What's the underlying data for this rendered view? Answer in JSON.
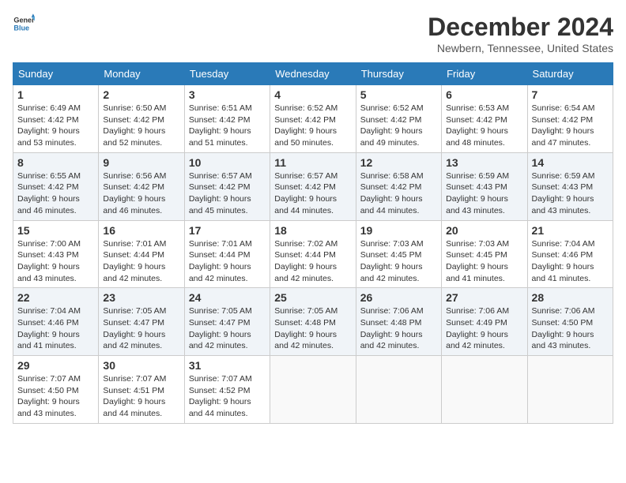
{
  "logo": {
    "text_general": "General",
    "text_blue": "Blue",
    "icon_title": "GeneralBlue logo"
  },
  "header": {
    "month": "December 2024",
    "location": "Newbern, Tennessee, United States"
  },
  "weekdays": [
    "Sunday",
    "Monday",
    "Tuesday",
    "Wednesday",
    "Thursday",
    "Friday",
    "Saturday"
  ],
  "weeks": [
    [
      {
        "day": "1",
        "sunrise": "6:49 AM",
        "sunset": "4:42 PM",
        "daylight": "9 hours and 53 minutes."
      },
      {
        "day": "2",
        "sunrise": "6:50 AM",
        "sunset": "4:42 PM",
        "daylight": "9 hours and 52 minutes."
      },
      {
        "day": "3",
        "sunrise": "6:51 AM",
        "sunset": "4:42 PM",
        "daylight": "9 hours and 51 minutes."
      },
      {
        "day": "4",
        "sunrise": "6:52 AM",
        "sunset": "4:42 PM",
        "daylight": "9 hours and 50 minutes."
      },
      {
        "day": "5",
        "sunrise": "6:52 AM",
        "sunset": "4:42 PM",
        "daylight": "9 hours and 49 minutes."
      },
      {
        "day": "6",
        "sunrise": "6:53 AM",
        "sunset": "4:42 PM",
        "daylight": "9 hours and 48 minutes."
      },
      {
        "day": "7",
        "sunrise": "6:54 AM",
        "sunset": "4:42 PM",
        "daylight": "9 hours and 47 minutes."
      }
    ],
    [
      {
        "day": "8",
        "sunrise": "6:55 AM",
        "sunset": "4:42 PM",
        "daylight": "9 hours and 46 minutes."
      },
      {
        "day": "9",
        "sunrise": "6:56 AM",
        "sunset": "4:42 PM",
        "daylight": "9 hours and 46 minutes."
      },
      {
        "day": "10",
        "sunrise": "6:57 AM",
        "sunset": "4:42 PM",
        "daylight": "9 hours and 45 minutes."
      },
      {
        "day": "11",
        "sunrise": "6:57 AM",
        "sunset": "4:42 PM",
        "daylight": "9 hours and 44 minutes."
      },
      {
        "day": "12",
        "sunrise": "6:58 AM",
        "sunset": "4:42 PM",
        "daylight": "9 hours and 44 minutes."
      },
      {
        "day": "13",
        "sunrise": "6:59 AM",
        "sunset": "4:43 PM",
        "daylight": "9 hours and 43 minutes."
      },
      {
        "day": "14",
        "sunrise": "6:59 AM",
        "sunset": "4:43 PM",
        "daylight": "9 hours and 43 minutes."
      }
    ],
    [
      {
        "day": "15",
        "sunrise": "7:00 AM",
        "sunset": "4:43 PM",
        "daylight": "9 hours and 43 minutes."
      },
      {
        "day": "16",
        "sunrise": "7:01 AM",
        "sunset": "4:44 PM",
        "daylight": "9 hours and 42 minutes."
      },
      {
        "day": "17",
        "sunrise": "7:01 AM",
        "sunset": "4:44 PM",
        "daylight": "9 hours and 42 minutes."
      },
      {
        "day": "18",
        "sunrise": "7:02 AM",
        "sunset": "4:44 PM",
        "daylight": "9 hours and 42 minutes."
      },
      {
        "day": "19",
        "sunrise": "7:03 AM",
        "sunset": "4:45 PM",
        "daylight": "9 hours and 42 minutes."
      },
      {
        "day": "20",
        "sunrise": "7:03 AM",
        "sunset": "4:45 PM",
        "daylight": "9 hours and 41 minutes."
      },
      {
        "day": "21",
        "sunrise": "7:04 AM",
        "sunset": "4:46 PM",
        "daylight": "9 hours and 41 minutes."
      }
    ],
    [
      {
        "day": "22",
        "sunrise": "7:04 AM",
        "sunset": "4:46 PM",
        "daylight": "9 hours and 41 minutes."
      },
      {
        "day": "23",
        "sunrise": "7:05 AM",
        "sunset": "4:47 PM",
        "daylight": "9 hours and 42 minutes."
      },
      {
        "day": "24",
        "sunrise": "7:05 AM",
        "sunset": "4:47 PM",
        "daylight": "9 hours and 42 minutes."
      },
      {
        "day": "25",
        "sunrise": "7:05 AM",
        "sunset": "4:48 PM",
        "daylight": "9 hours and 42 minutes."
      },
      {
        "day": "26",
        "sunrise": "7:06 AM",
        "sunset": "4:48 PM",
        "daylight": "9 hours and 42 minutes."
      },
      {
        "day": "27",
        "sunrise": "7:06 AM",
        "sunset": "4:49 PM",
        "daylight": "9 hours and 42 minutes."
      },
      {
        "day": "28",
        "sunrise": "7:06 AM",
        "sunset": "4:50 PM",
        "daylight": "9 hours and 43 minutes."
      }
    ],
    [
      {
        "day": "29",
        "sunrise": "7:07 AM",
        "sunset": "4:50 PM",
        "daylight": "9 hours and 43 minutes."
      },
      {
        "day": "30",
        "sunrise": "7:07 AM",
        "sunset": "4:51 PM",
        "daylight": "9 hours and 44 minutes."
      },
      {
        "day": "31",
        "sunrise": "7:07 AM",
        "sunset": "4:52 PM",
        "daylight": "9 hours and 44 minutes."
      },
      null,
      null,
      null,
      null
    ]
  ],
  "labels": {
    "sunrise": "Sunrise:",
    "sunset": "Sunset:",
    "daylight": "Daylight:"
  }
}
